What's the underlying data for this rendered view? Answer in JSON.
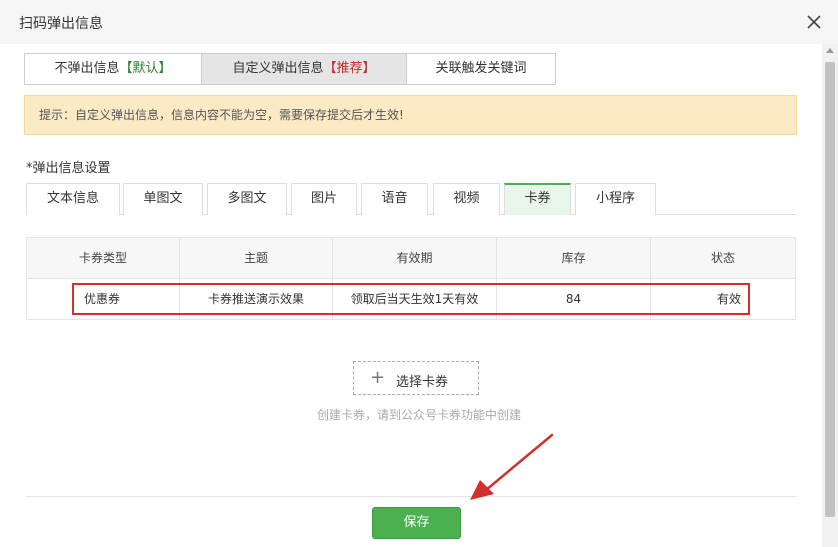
{
  "dialog": {
    "title": "扫码弹出信息"
  },
  "modes": [
    {
      "label": "不弹出信息",
      "tag": "【默认】",
      "tag_color": "#2e7d32"
    },
    {
      "label": "自定义弹出信息",
      "tag": "【推荐】",
      "tag_color": "#c62828",
      "active": true
    },
    {
      "label": "关联触发关键词",
      "tag": ""
    }
  ],
  "tip": "提示：自定义弹出信息，信息内容不能为空，需要保存提交后才生效!",
  "section": {
    "label": "*弹出信息设置"
  },
  "types": [
    "文本信息",
    "单图文",
    "多图文",
    "图片",
    "语音",
    "视频",
    "卡券",
    "小程序"
  ],
  "types_active": "卡券",
  "table": {
    "headers": [
      "卡券类型",
      "主题",
      "有效期",
      "库存",
      "状态"
    ],
    "rows": [
      [
        "优惠券",
        "卡券推送演示效果",
        "领取后当天生效1天有效",
        "84",
        "有效"
      ]
    ]
  },
  "select_card": {
    "label": "选择卡券"
  },
  "hint": "创建卡券，请到公众号卡券功能中创建",
  "save": {
    "label": "保存"
  },
  "colors": {
    "accent": "#4caf50",
    "annotation": "#d32f2f",
    "tip_bg": "#fbeac3"
  }
}
